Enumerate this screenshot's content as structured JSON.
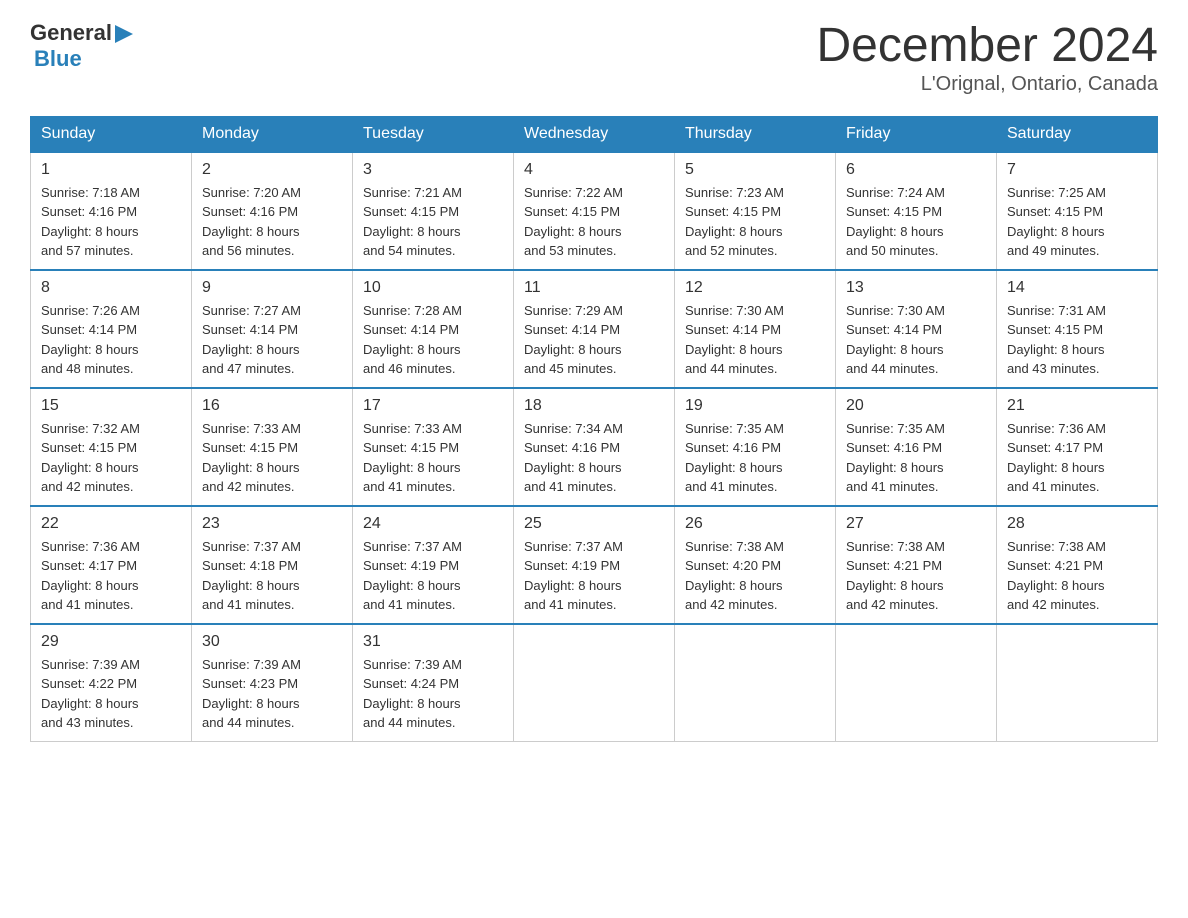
{
  "header": {
    "logo": {
      "text_general": "General",
      "text_blue": "Blue",
      "aria": "GeneralBlue Logo"
    },
    "month_title": "December 2024",
    "location": "L'Orignal, Ontario, Canada"
  },
  "days_of_week": [
    "Sunday",
    "Monday",
    "Tuesday",
    "Wednesday",
    "Thursday",
    "Friday",
    "Saturday"
  ],
  "weeks": [
    [
      {
        "day": "1",
        "sunrise": "7:18 AM",
        "sunset": "4:16 PM",
        "daylight": "8 hours and 57 minutes."
      },
      {
        "day": "2",
        "sunrise": "7:20 AM",
        "sunset": "4:16 PM",
        "daylight": "8 hours and 56 minutes."
      },
      {
        "day": "3",
        "sunrise": "7:21 AM",
        "sunset": "4:15 PM",
        "daylight": "8 hours and 54 minutes."
      },
      {
        "day": "4",
        "sunrise": "7:22 AM",
        "sunset": "4:15 PM",
        "daylight": "8 hours and 53 minutes."
      },
      {
        "day": "5",
        "sunrise": "7:23 AM",
        "sunset": "4:15 PM",
        "daylight": "8 hours and 52 minutes."
      },
      {
        "day": "6",
        "sunrise": "7:24 AM",
        "sunset": "4:15 PM",
        "daylight": "8 hours and 50 minutes."
      },
      {
        "day": "7",
        "sunrise": "7:25 AM",
        "sunset": "4:15 PM",
        "daylight": "8 hours and 49 minutes."
      }
    ],
    [
      {
        "day": "8",
        "sunrise": "7:26 AM",
        "sunset": "4:14 PM",
        "daylight": "8 hours and 48 minutes."
      },
      {
        "day": "9",
        "sunrise": "7:27 AM",
        "sunset": "4:14 PM",
        "daylight": "8 hours and 47 minutes."
      },
      {
        "day": "10",
        "sunrise": "7:28 AM",
        "sunset": "4:14 PM",
        "daylight": "8 hours and 46 minutes."
      },
      {
        "day": "11",
        "sunrise": "7:29 AM",
        "sunset": "4:14 PM",
        "daylight": "8 hours and 45 minutes."
      },
      {
        "day": "12",
        "sunrise": "7:30 AM",
        "sunset": "4:14 PM",
        "daylight": "8 hours and 44 minutes."
      },
      {
        "day": "13",
        "sunrise": "7:30 AM",
        "sunset": "4:14 PM",
        "daylight": "8 hours and 44 minutes."
      },
      {
        "day": "14",
        "sunrise": "7:31 AM",
        "sunset": "4:15 PM",
        "daylight": "8 hours and 43 minutes."
      }
    ],
    [
      {
        "day": "15",
        "sunrise": "7:32 AM",
        "sunset": "4:15 PM",
        "daylight": "8 hours and 42 minutes."
      },
      {
        "day": "16",
        "sunrise": "7:33 AM",
        "sunset": "4:15 PM",
        "daylight": "8 hours and 42 minutes."
      },
      {
        "day": "17",
        "sunrise": "7:33 AM",
        "sunset": "4:15 PM",
        "daylight": "8 hours and 41 minutes."
      },
      {
        "day": "18",
        "sunrise": "7:34 AM",
        "sunset": "4:16 PM",
        "daylight": "8 hours and 41 minutes."
      },
      {
        "day": "19",
        "sunrise": "7:35 AM",
        "sunset": "4:16 PM",
        "daylight": "8 hours and 41 minutes."
      },
      {
        "day": "20",
        "sunrise": "7:35 AM",
        "sunset": "4:16 PM",
        "daylight": "8 hours and 41 minutes."
      },
      {
        "day": "21",
        "sunrise": "7:36 AM",
        "sunset": "4:17 PM",
        "daylight": "8 hours and 41 minutes."
      }
    ],
    [
      {
        "day": "22",
        "sunrise": "7:36 AM",
        "sunset": "4:17 PM",
        "daylight": "8 hours and 41 minutes."
      },
      {
        "day": "23",
        "sunrise": "7:37 AM",
        "sunset": "4:18 PM",
        "daylight": "8 hours and 41 minutes."
      },
      {
        "day": "24",
        "sunrise": "7:37 AM",
        "sunset": "4:19 PM",
        "daylight": "8 hours and 41 minutes."
      },
      {
        "day": "25",
        "sunrise": "7:37 AM",
        "sunset": "4:19 PM",
        "daylight": "8 hours and 41 minutes."
      },
      {
        "day": "26",
        "sunrise": "7:38 AM",
        "sunset": "4:20 PM",
        "daylight": "8 hours and 42 minutes."
      },
      {
        "day": "27",
        "sunrise": "7:38 AM",
        "sunset": "4:21 PM",
        "daylight": "8 hours and 42 minutes."
      },
      {
        "day": "28",
        "sunrise": "7:38 AM",
        "sunset": "4:21 PM",
        "daylight": "8 hours and 42 minutes."
      }
    ],
    [
      {
        "day": "29",
        "sunrise": "7:39 AM",
        "sunset": "4:22 PM",
        "daylight": "8 hours and 43 minutes."
      },
      {
        "day": "30",
        "sunrise": "7:39 AM",
        "sunset": "4:23 PM",
        "daylight": "8 hours and 44 minutes."
      },
      {
        "day": "31",
        "sunrise": "7:39 AM",
        "sunset": "4:24 PM",
        "daylight": "8 hours and 44 minutes."
      },
      null,
      null,
      null,
      null
    ]
  ],
  "labels": {
    "sunrise": "Sunrise:",
    "sunset": "Sunset:",
    "daylight": "Daylight:"
  },
  "colors": {
    "header_bg": "#2980b9",
    "header_text": "#ffffff",
    "border": "#2980b9"
  }
}
